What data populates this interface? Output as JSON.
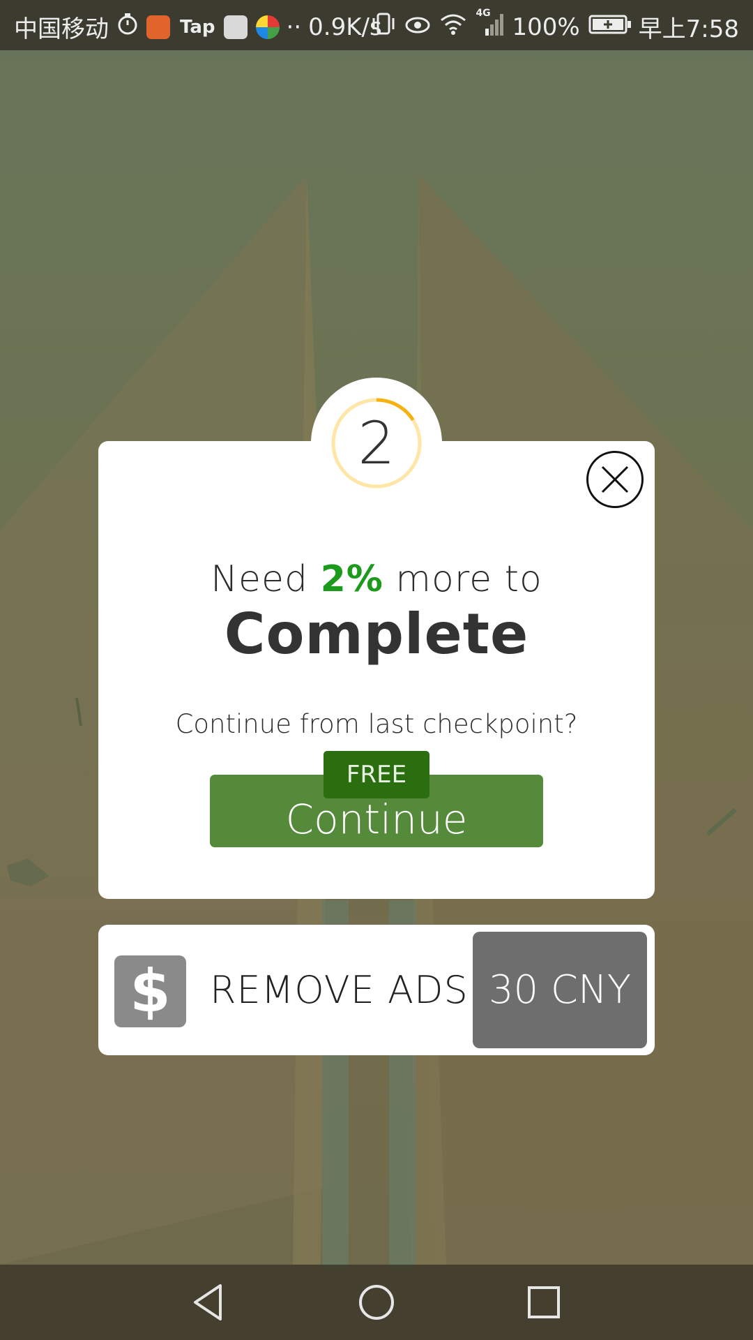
{
  "status_bar": {
    "carrier": "中国移动",
    "app_tap": "Tap",
    "network_speed": "0.9K/s",
    "network_type": "4G",
    "battery": "100%",
    "time": "早上7:58",
    "icons": [
      "stopwatch-icon",
      "health-app-icon",
      "tap-app-icon",
      "huawei-app-icon",
      "photos-app-icon",
      "vibrate-icon",
      "eye-comfort-icon",
      "wifi-icon",
      "signal-icon",
      "battery-icon"
    ]
  },
  "badge": {
    "number": "2",
    "progress": 0.16,
    "ring_color": "#ffe6a6",
    "progress_color": "#f5b212"
  },
  "card": {
    "need_prefix": "Need",
    "need_percent": "2%",
    "need_suffix": "more to",
    "complete": "Complete",
    "checkpoint_question": "Continue from last checkpoint?",
    "free_tag": "FREE",
    "continue_label": "Continue",
    "close_icon": "close-icon"
  },
  "remove_ads": {
    "icon": "dollar-icon",
    "icon_glyph": "$",
    "label": "REMOVE ADS",
    "price": "30 CNY"
  },
  "nav_bar": {
    "icons": [
      "back-icon",
      "home-icon",
      "recents-icon"
    ]
  },
  "colors": {
    "accent_green": "#548a3a",
    "free_green": "#2b6e10",
    "percent_green": "#1c9a1c",
    "price_gray": "#6e6e6e"
  }
}
